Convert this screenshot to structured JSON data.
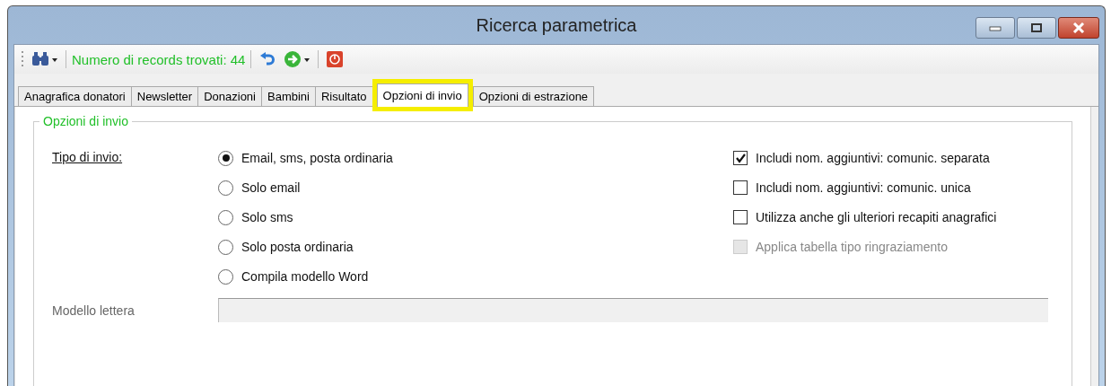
{
  "window": {
    "title": "Ricerca parametrica"
  },
  "toolbar": {
    "records_label": "Numero di records trovati: 44"
  },
  "tabs": [
    {
      "label": "Anagrafica donatori",
      "selected": false,
      "highlighted": false
    },
    {
      "label": "Newsletter",
      "selected": false,
      "highlighted": false
    },
    {
      "label": "Donazioni",
      "selected": false,
      "highlighted": false
    },
    {
      "label": "Bambini",
      "selected": false,
      "highlighted": false
    },
    {
      "label": "Risultato",
      "selected": false,
      "highlighted": false
    },
    {
      "label": "Opzioni di invio",
      "selected": true,
      "highlighted": true
    },
    {
      "label": "Opzioni di estrazione",
      "selected": false,
      "highlighted": false
    }
  ],
  "group": {
    "title": "Opzioni di invio",
    "send_type_label": "Tipo di invio:",
    "radios": [
      {
        "label": "Email, sms, posta ordinaria",
        "selected": true
      },
      {
        "label": "Solo email",
        "selected": false
      },
      {
        "label": "Solo sms",
        "selected": false
      },
      {
        "label": "Solo posta ordinaria",
        "selected": false
      },
      {
        "label": "Compila modello Word",
        "selected": false
      }
    ],
    "checkboxes": [
      {
        "label": "Includi nom. aggiuntivi: comunic. separata",
        "checked": true,
        "disabled": false
      },
      {
        "label": "Includi nom. aggiuntivi: comunic. unica",
        "checked": false,
        "disabled": false
      },
      {
        "label": "Utilizza anche gli ulteriori recapiti anagrafici",
        "checked": false,
        "disabled": false
      },
      {
        "label": "Applica tabella tipo ringraziamento",
        "checked": false,
        "disabled": true
      }
    ],
    "template_label": "Modello lettera"
  }
}
